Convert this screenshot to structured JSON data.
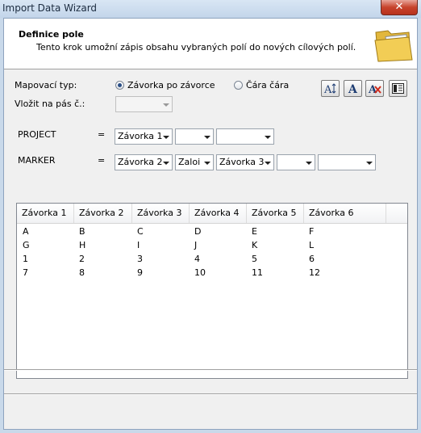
{
  "window": {
    "title": "Import Data Wizard",
    "close_label": "✕"
  },
  "header": {
    "title": "Definice pole",
    "description": "Tento krok umožní zápis obsahu vybraných polí do nových cílových polí."
  },
  "mapping": {
    "label": "Mapovací typ:",
    "option_bracket": "Závorka po závorce",
    "option_line": "Čára čára",
    "selected": "option_bracket"
  },
  "insert": {
    "label": "Vložit na pás č.:",
    "value": ""
  },
  "toolbar": {
    "buttons": [
      "font-size-icon",
      "font-icon",
      "clear-font-icon",
      "layout-icon"
    ]
  },
  "fields": [
    {
      "name": "PROJECT",
      "equals": "=",
      "combos": [
        "Závorka 1",
        "",
        ""
      ]
    },
    {
      "name": "MARKER",
      "equals": "=",
      "combos": [
        "Závorka 2",
        "Zaloi",
        "Závorka 3",
        "",
        ""
      ]
    }
  ],
  "table": {
    "headers": [
      "Závorka 1",
      "Závorka 2",
      "Závorka 3",
      "Závorka 4",
      "Závorka 5",
      "Závorka 6"
    ],
    "rows": [
      [
        "A",
        "B",
        "C",
        "D",
        "E",
        "F"
      ],
      [
        "G",
        "H",
        "I",
        "J",
        "K",
        "L"
      ],
      [
        "1",
        "2",
        "3",
        "4",
        "5",
        "6"
      ],
      [
        "7",
        "8",
        "9",
        "10",
        "11",
        "12"
      ]
    ]
  }
}
